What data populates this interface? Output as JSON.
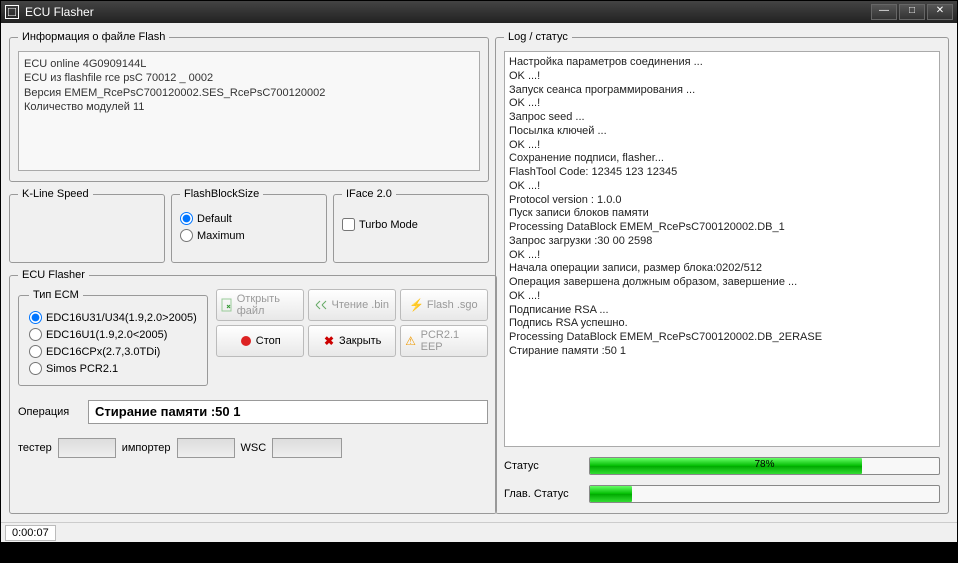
{
  "window": {
    "title": "ECU Flasher"
  },
  "flashinfo": {
    "legend": "Информация о файле Flash",
    "lines": [
      "ECU online 4G0909144L",
      "ECU из flashfile rce psC 70012 _ 0002",
      "Версия EMEM_RcePsC700120002.SES_RcePsC700120002",
      "Количество модулей 11"
    ]
  },
  "kline": {
    "legend": "K-Line Speed"
  },
  "fbs": {
    "legend": "FlashBlockSize",
    "options": {
      "default": "Default",
      "maximum": "Maximum"
    },
    "selected": "default"
  },
  "iface": {
    "legend": "IFace 2.0",
    "turbo": "Turbo Mode",
    "turbo_checked": false
  },
  "ecuflasher": {
    "legend": "ECU Flasher",
    "ecm_legend": "Тип ECM",
    "ecm_options": [
      {
        "id": "e0",
        "label": "EDC16U31/U34(1.9,2.0>2005)",
        "checked": true
      },
      {
        "id": "e1",
        "label": "EDC16U1(1.9,2.0<2005)",
        "checked": false
      },
      {
        "id": "e2",
        "label": "EDC16CPx(2.7,3.0TDi)",
        "checked": false
      },
      {
        "id": "e3",
        "label": "Simos PCR2.1",
        "checked": false
      }
    ],
    "buttons": {
      "open": "Открыть файл",
      "read": "Чтение .bin",
      "flash": "Flash .sgo",
      "stop": "Стоп",
      "close": "Закрыть",
      "pcr": "PCR2.1 EEP"
    },
    "operation_label": "Операция",
    "operation_value": "Стирание памяти :50 1",
    "bottom": {
      "tester": "тестер",
      "importer": "импортер",
      "wsc": "WSC"
    }
  },
  "log": {
    "legend": "Log / статус",
    "lines": [
      "Настройка параметров соединения ...",
      "OK ...!",
      "Запуск сеанса программирования ...",
      "OK ...!",
      "Запрос seed ...",
      "Посылка ключей ...",
      "OK ...!",
      "Сохранение подписи, flasher...",
      "FlashTool Code: 12345 123 12345",
      "OK ...!",
      "Protocol version : 1.0.0",
      "Пуск записи блоков памяти",
      "Processing DataBlock EMEM_RcePsC700120002.DB_1",
      "Запрос загрузки :30 00 2598",
      "OK ...!",
      "Начала операции записи, размер блока:0202/512",
      "Операция завершена должным образом, завершение ...",
      "OK ...!",
      "Подписание RSA ...",
      "Подпись RSA успешно.",
      "Processing DataBlock EMEM_RcePsC700120002.DB_2ERASE",
      "Стирание памяти :50 1"
    ],
    "status_label": "Статус",
    "status_pct": "78%",
    "status_width": "78%",
    "main_status_label": "Глав. Статус",
    "main_status_width": "12%"
  },
  "statusbar": {
    "time": "0:00:07"
  }
}
